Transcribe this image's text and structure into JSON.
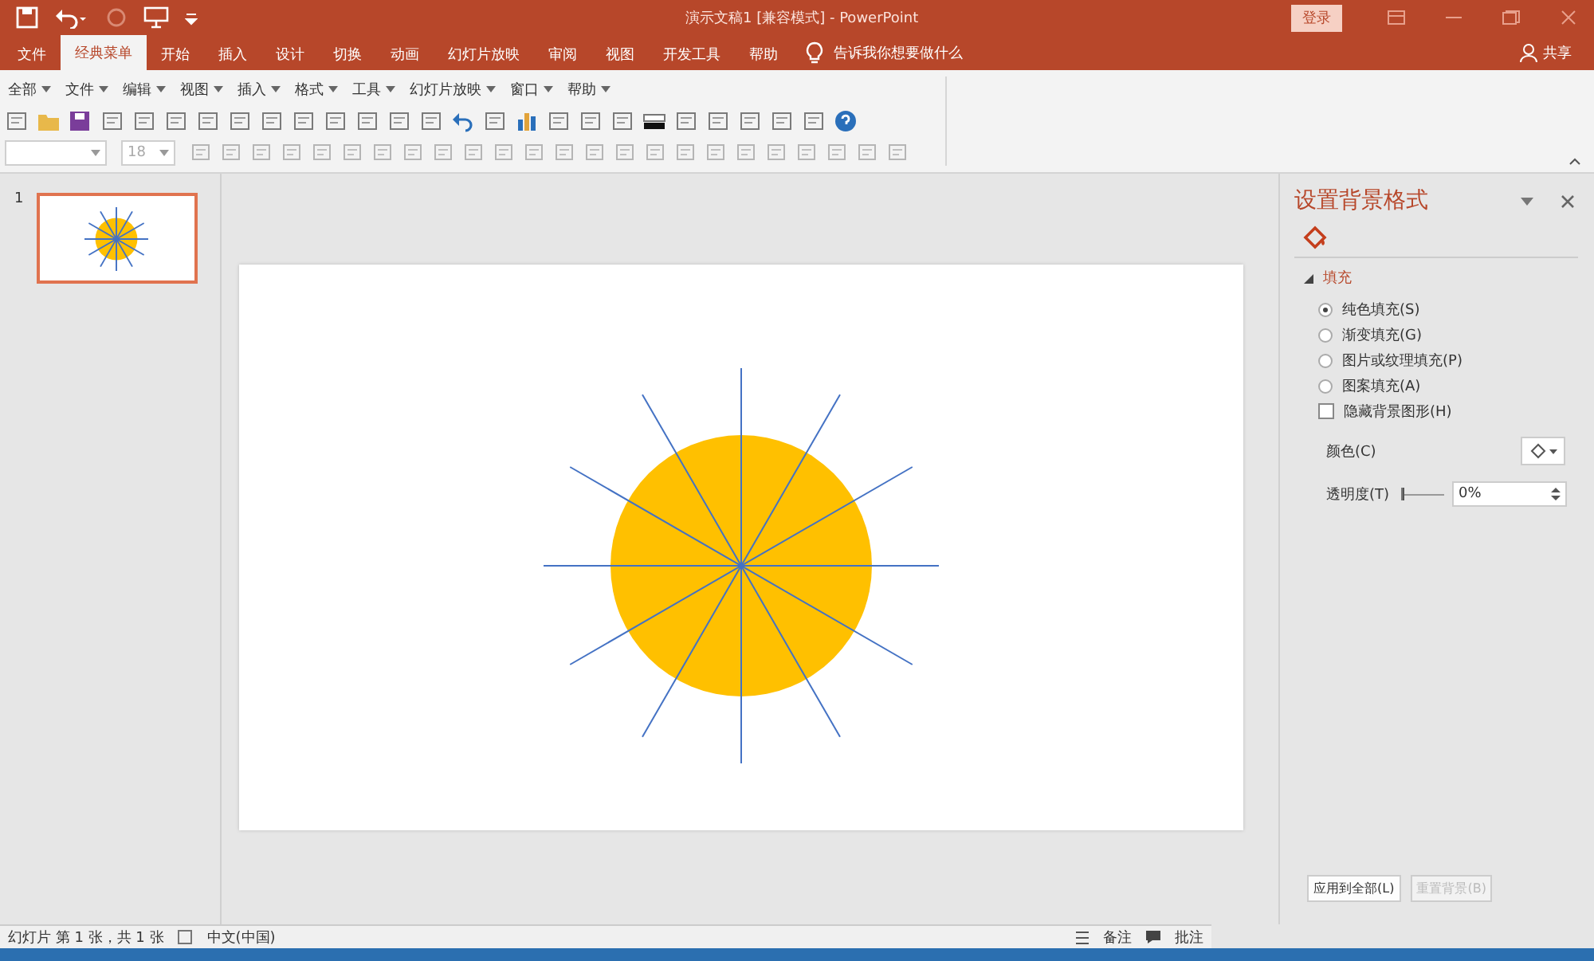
{
  "window": {
    "title": "演示文稿1 [兼容模式]  -  PowerPoint",
    "signin": "登录"
  },
  "tabs": [
    {
      "label": "文件",
      "selected": false
    },
    {
      "label": "经典菜单",
      "selected": true
    },
    {
      "label": "开始",
      "selected": false
    },
    {
      "label": "插入",
      "selected": false
    },
    {
      "label": "设计",
      "selected": false
    },
    {
      "label": "切换",
      "selected": false
    },
    {
      "label": "动画",
      "selected": false
    },
    {
      "label": "幻灯片放映",
      "selected": false
    },
    {
      "label": "审阅",
      "selected": false
    },
    {
      "label": "视图",
      "selected": false
    },
    {
      "label": "开发工具",
      "selected": false
    },
    {
      "label": "帮助",
      "selected": false
    }
  ],
  "tell_me": "告诉我你想要做什么",
  "share": "共享",
  "classic_menu": [
    "全部",
    "文件",
    "编辑",
    "视图",
    "插入",
    "格式",
    "工具",
    "幻灯片放映",
    "窗口",
    "帮助"
  ],
  "font_size": "18",
  "thumbnails": [
    {
      "number": "1",
      "selected": true
    }
  ],
  "pane": {
    "title": "设置背景格式",
    "section": "填充",
    "expanded": true,
    "fill_options": [
      {
        "label": "纯色填充(S)",
        "selected": true
      },
      {
        "label": "渐变填充(G)",
        "selected": false
      },
      {
        "label": "图片或纹理填充(P)",
        "selected": false
      },
      {
        "label": "图案填充(A)",
        "selected": false
      }
    ],
    "hide_graphics": {
      "label": "隐藏背景图形(H)",
      "checked": false
    },
    "color_label": "颜色(C)",
    "transparency_label": "透明度(T)",
    "transparency": {
      "value": "0%",
      "level": 0
    },
    "apply_all": "应用到全部(L)",
    "reset": "重置背景(B)"
  },
  "status_bar": {
    "slide_info": "幻灯片 第 1 张，共 1 张",
    "language": "中文(中国)",
    "notes": "备注",
    "comments": "批注"
  }
}
